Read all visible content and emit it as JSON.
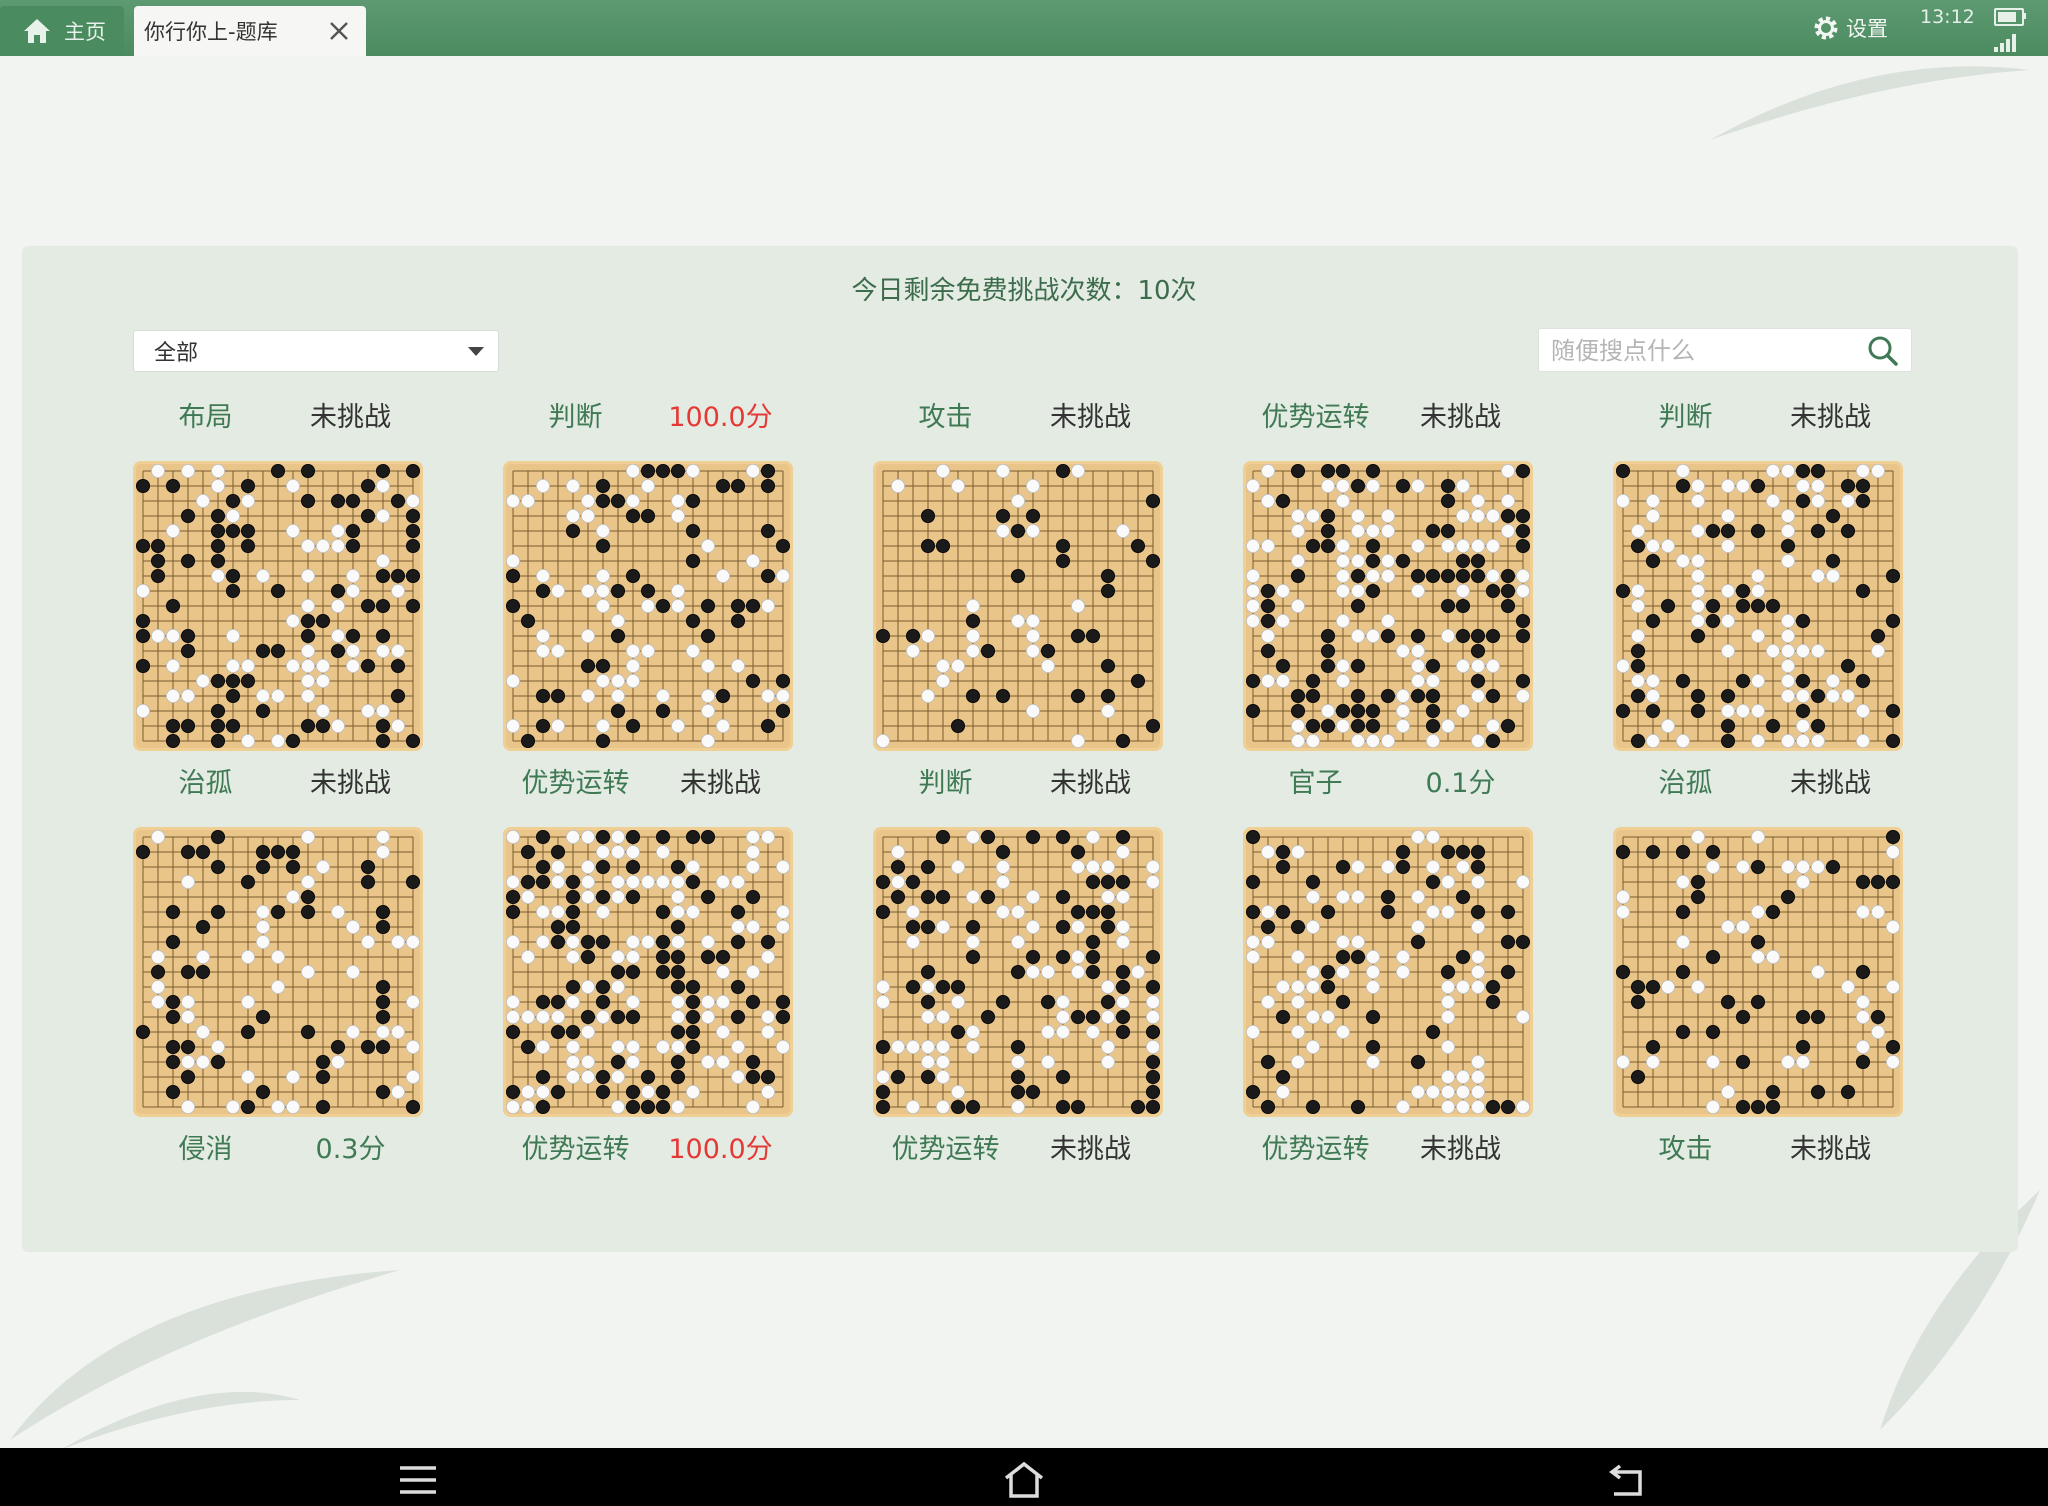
{
  "tabs": {
    "home_label": "主页",
    "active_label": "你行你上-题库"
  },
  "status": {
    "settings_label": "设置",
    "time": "13:12"
  },
  "header": {
    "remaining_text": "今日剩余免费挑战次数：10次"
  },
  "filter": {
    "selected": "全部"
  },
  "search": {
    "placeholder": "随便搜点什么"
  },
  "colors": {
    "accent": "#4c8a60",
    "label_green": "#3f7a55",
    "score_red": "#e53935",
    "board": "#e9c58a"
  },
  "problems": [
    {
      "category": "布局",
      "status": "未挑战",
      "status_color": "dark"
    },
    {
      "category": "判断",
      "status": "100.0分",
      "status_color": "red"
    },
    {
      "category": "攻击",
      "status": "未挑战",
      "status_color": "dark"
    },
    {
      "category": "优势运转",
      "status": "未挑战",
      "status_color": "dark"
    },
    {
      "category": "判断",
      "status": "未挑战",
      "status_color": "dark"
    },
    {
      "category": "治孤",
      "status": "未挑战",
      "status_color": "dark"
    },
    {
      "category": "优势运转",
      "status": "未挑战",
      "status_color": "dark"
    },
    {
      "category": "判断",
      "status": "未挑战",
      "status_color": "dark"
    },
    {
      "category": "官子",
      "status": "0.1分",
      "status_color": "green"
    },
    {
      "category": "治孤",
      "status": "未挑战",
      "status_color": "dark"
    },
    {
      "category": "侵消",
      "status": "0.3分",
      "status_color": "green"
    },
    {
      "category": "优势运转",
      "status": "100.0分",
      "status_color": "red"
    },
    {
      "category": "优势运转",
      "status": "未挑战",
      "status_color": "dark"
    },
    {
      "category": "优势运转",
      "status": "未挑战",
      "status_color": "dark"
    },
    {
      "category": "攻击",
      "status": "未挑战",
      "status_color": "dark"
    }
  ]
}
